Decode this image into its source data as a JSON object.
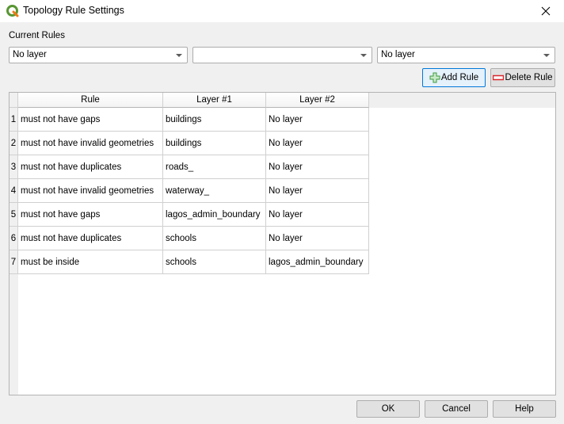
{
  "window": {
    "title": "Topology Rule Settings",
    "icon": "qgis-logo-icon",
    "close_icon": "close-icon"
  },
  "current_rules": {
    "label": "Current Rules",
    "layer1_combo": {
      "value": "No layer"
    },
    "rule_combo": {
      "value": ""
    },
    "layer2_combo": {
      "value": "No layer"
    },
    "add_rule_label": "Add Rule",
    "delete_rule_label": "Delete Rule"
  },
  "table": {
    "columns": [
      "Rule",
      "Layer #1",
      "Layer #2"
    ],
    "rows": [
      {
        "num": "1",
        "rule": "must not have gaps",
        "layer1": "buildings",
        "layer2": "No layer"
      },
      {
        "num": "2",
        "rule": "must not have invalid geometries",
        "layer1": "buildings",
        "layer2": "No layer"
      },
      {
        "num": "3",
        "rule": "must not have duplicates",
        "layer1": "roads_",
        "layer2": "No layer"
      },
      {
        "num": "4",
        "rule": "must not have invalid geometries",
        "layer1": "waterway_",
        "layer2": "No layer"
      },
      {
        "num": "5",
        "rule": "must not have gaps",
        "layer1": "lagos_admin_boundary",
        "layer2": "No layer"
      },
      {
        "num": "6",
        "rule": "must not have duplicates",
        "layer1": "schools",
        "layer2": "No layer"
      },
      {
        "num": "7",
        "rule": "must be inside",
        "layer1": "schools",
        "layer2": "lagos_admin_boundary"
      }
    ]
  },
  "footer": {
    "ok_label": "OK",
    "cancel_label": "Cancel",
    "help_label": "Help"
  },
  "colors": {
    "add_icon": "#3d9a3d",
    "delete_icon": "#d9262b",
    "focus_border": "#0078d7"
  }
}
